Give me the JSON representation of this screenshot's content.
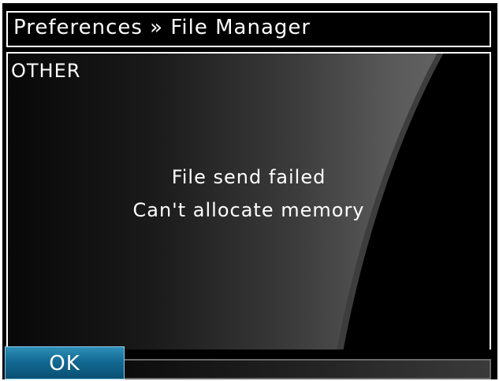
{
  "window": {
    "title": "Preferences » File Manager"
  },
  "section": {
    "label": "OTHER"
  },
  "message": {
    "line1": "File send failed",
    "line2": "Can't allocate memory"
  },
  "buttons": {
    "ok_label": "OK"
  },
  "colors": {
    "screen_background": "#000000",
    "text": "#ffffff",
    "button_blue": "#136a93",
    "button_border": "#8fd0ee"
  }
}
